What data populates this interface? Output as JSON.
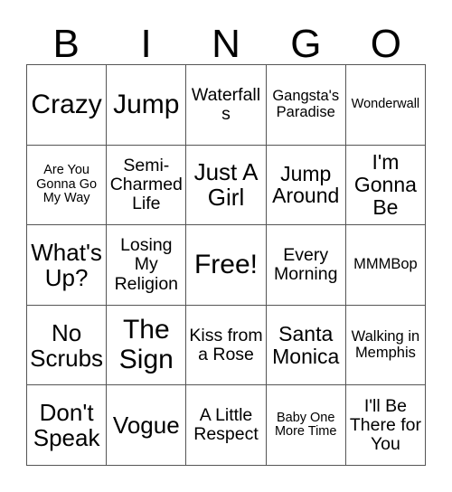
{
  "card": {
    "title_letters": [
      "B",
      "I",
      "N",
      "G",
      "O"
    ],
    "columns": 5,
    "rows": 5,
    "free_space_label": "Free!",
    "free_space_position": {
      "row": 3,
      "column": 3
    },
    "colors": {
      "background": "#ffffff",
      "text": "#000000",
      "grid_line": "#555555"
    },
    "grid": [
      [
        {
          "label": "Crazy",
          "size": "xxl"
        },
        {
          "label": "Jump",
          "size": "xxl"
        },
        {
          "label": "Waterfalls",
          "size": "md"
        },
        {
          "label": "Gangsta's Paradise",
          "size": "sm"
        },
        {
          "label": "Wonderwall",
          "size": "xs"
        }
      ],
      [
        {
          "label": "Are You Gonna Go My Way",
          "size": "xs"
        },
        {
          "label": "Semi-Charmed Life",
          "size": "md"
        },
        {
          "label": "Just A Girl",
          "size": "xl"
        },
        {
          "label": "Jump Around",
          "size": "lg"
        },
        {
          "label": "I'm Gonna Be",
          "size": "lg"
        }
      ],
      [
        {
          "label": "What's Up?",
          "size": "xl"
        },
        {
          "label": "Losing My Religion",
          "size": "md"
        },
        {
          "label": "Free!",
          "size": "xxl"
        },
        {
          "label": "Every Morning",
          "size": "md"
        },
        {
          "label": "MMMBop",
          "size": "sm"
        }
      ],
      [
        {
          "label": "No Scrubs",
          "size": "xl"
        },
        {
          "label": "The Sign",
          "size": "xxl"
        },
        {
          "label": "Kiss from a Rose",
          "size": "md"
        },
        {
          "label": "Santa Monica",
          "size": "lg"
        },
        {
          "label": "Walking in Memphis",
          "size": "sm"
        }
      ],
      [
        {
          "label": "Don't Speak",
          "size": "xl"
        },
        {
          "label": "Vogue",
          "size": "xl"
        },
        {
          "label": "A Little Respect",
          "size": "md"
        },
        {
          "label": "Baby One More Time",
          "size": "xs"
        },
        {
          "label": "I'll Be There for You",
          "size": "md"
        }
      ]
    ]
  }
}
